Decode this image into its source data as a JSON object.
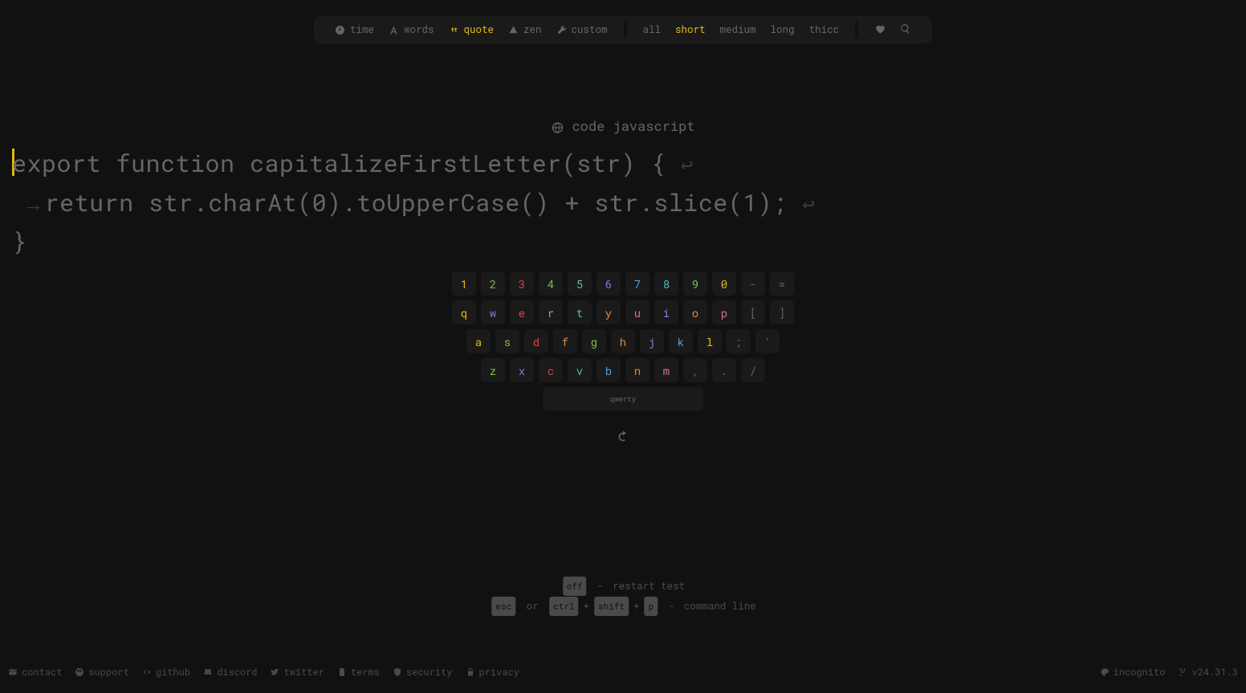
{
  "modes": {
    "time": "time",
    "words": "words",
    "quote": "quote",
    "zen": "zen",
    "custom": "custom"
  },
  "lengths": {
    "all": "all",
    "short": "short",
    "medium": "medium",
    "long": "long",
    "thicc": "thicc"
  },
  "language": {
    "label": "code javascript"
  },
  "typing": {
    "line1": "export function capitalizeFirstLetter(str) {",
    "line2": "return str.charAt(0).toUpperCase() + str.slice(1);",
    "line3": "}",
    "newline_glyph": "↩",
    "indent_glyph": "→"
  },
  "keymap": {
    "rows": [
      [
        {
          "k": "1",
          "c": "c-yellow"
        },
        {
          "k": "2",
          "c": "c-green"
        },
        {
          "k": "3",
          "c": "c-red"
        },
        {
          "k": "4",
          "c": "c-green"
        },
        {
          "k": "5",
          "c": "c-cyan"
        },
        {
          "k": "6",
          "c": "c-purple"
        },
        {
          "k": "7",
          "c": "c-blue"
        },
        {
          "k": "8",
          "c": "c-cyan"
        },
        {
          "k": "9",
          "c": "c-green"
        },
        {
          "k": "0",
          "c": "c-yellow"
        },
        {
          "k": "-",
          "c": "c-grey"
        },
        {
          "k": "=",
          "c": "c-grey"
        }
      ],
      [
        {
          "k": "q",
          "c": "c-yellow"
        },
        {
          "k": "w",
          "c": "c-purple"
        },
        {
          "k": "e",
          "c": "c-red"
        },
        {
          "k": "r",
          "c": "c-green"
        },
        {
          "k": "t",
          "c": "c-cyan"
        },
        {
          "k": "y",
          "c": "c-orange"
        },
        {
          "k": "u",
          "c": "c-pink"
        },
        {
          "k": "i",
          "c": "c-purple"
        },
        {
          "k": "o",
          "c": "c-orange"
        },
        {
          "k": "p",
          "c": "c-pink"
        },
        {
          "k": "[",
          "c": "c-grey"
        },
        {
          "k": "]",
          "c": "c-grey"
        }
      ],
      [
        {
          "k": "a",
          "c": "c-yellow"
        },
        {
          "k": "s",
          "c": "c-green"
        },
        {
          "k": "d",
          "c": "c-red"
        },
        {
          "k": "f",
          "c": "c-orange"
        },
        {
          "k": "g",
          "c": "c-green"
        },
        {
          "k": "h",
          "c": "c-orange"
        },
        {
          "k": "j",
          "c": "c-purple"
        },
        {
          "k": "k",
          "c": "c-blue"
        },
        {
          "k": "l",
          "c": "c-yellow"
        },
        {
          "k": ";",
          "c": "c-grey"
        },
        {
          "k": "'",
          "c": "c-grey"
        }
      ],
      [
        {
          "k": "z",
          "c": "c-green"
        },
        {
          "k": "x",
          "c": "c-purple"
        },
        {
          "k": "c",
          "c": "c-red"
        },
        {
          "k": "v",
          "c": "c-cyan"
        },
        {
          "k": "b",
          "c": "c-blue"
        },
        {
          "k": "n",
          "c": "c-orange"
        },
        {
          "k": "m",
          "c": "c-pink"
        },
        {
          "k": ",",
          "c": "c-grey"
        },
        {
          "k": ".",
          "c": "c-grey"
        },
        {
          "k": "/",
          "c": "c-grey"
        }
      ]
    ],
    "space_label": "qwerty"
  },
  "hints": {
    "restart_key": "off",
    "restart_label": "restart test",
    "cmd_ctrl": "ctrl",
    "cmd_shift": "shift",
    "cmd_p": "p",
    "cmd_esc": "esc",
    "cmd_or": "or",
    "cmd_plus": "+",
    "cmd_label": "command line",
    "dash": "-"
  },
  "footer": {
    "contact": "contact",
    "support": "support",
    "github": "github",
    "discord": "discord",
    "twitter": "twitter",
    "terms": "terms",
    "security": "security",
    "privacy": "privacy",
    "incognito": "incognito",
    "version": "v24.31.3"
  }
}
